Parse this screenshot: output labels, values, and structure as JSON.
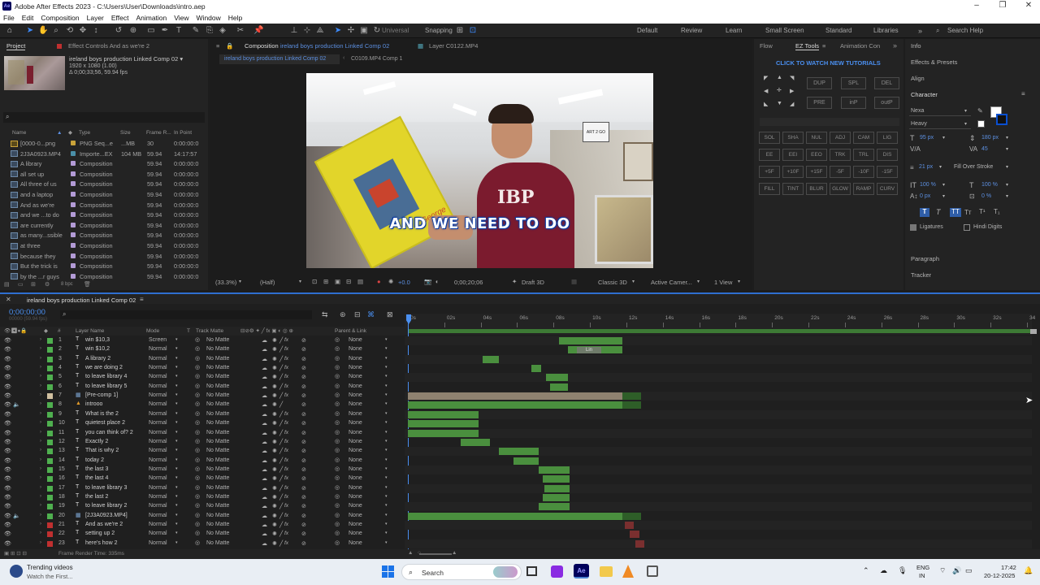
{
  "window": {
    "title": "Adobe After Effects 2023 - C:\\Users\\User\\Downloads\\intro.aep",
    "logo": "Ae"
  },
  "menu": [
    "File",
    "Edit",
    "Composition",
    "Layer",
    "Effect",
    "Animation",
    "View",
    "Window",
    "Help"
  ],
  "toolbar": {
    "universal": "Universal",
    "snapping": "Snapping"
  },
  "workspaces": [
    "Default",
    "Review",
    "Learn",
    "Small Screen",
    "Standard",
    "Libraries"
  ],
  "search_help": "Search Help",
  "project": {
    "tab": "Project",
    "effect_tab": "Effect Controls And as we're 2",
    "comp_name": "ireland boys production Linked Comp 02 ▾",
    "comp_res": "1920 x 1080 (1.00)",
    "comp_dur": "Δ 0;00;33;56, 59.94 fps",
    "headers": [
      "Name",
      "Type",
      "Size",
      "Frame R...",
      "In Point"
    ],
    "bpc": "8 bpc",
    "items": [
      {
        "name": "[0000-0...png",
        "type": "PNG Seq...e",
        "size": "...MB",
        "fr": "30",
        "in": "0:00:00:0",
        "kind": "seq",
        "color": "#c9a33a"
      },
      {
        "name": "2J3A0923.MP4",
        "type": "Importe...EX",
        "size": "104 MB",
        "fr": "59.94",
        "in": "14:17:57",
        "kind": "mov",
        "color": "#4a8fa8"
      },
      {
        "name": "A library",
        "type": "Composition",
        "size": "",
        "fr": "59.94",
        "in": "0:00:00:0",
        "kind": "comp",
        "color": "#b39bd6"
      },
      {
        "name": "all set up",
        "type": "Composition",
        "size": "",
        "fr": "59.94",
        "in": "0:00:00:0",
        "kind": "comp",
        "color": "#b39bd6"
      },
      {
        "name": "All three of us",
        "type": "Composition",
        "size": "",
        "fr": "59.94",
        "in": "0:00:00:0",
        "kind": "comp",
        "color": "#b39bd6"
      },
      {
        "name": "and a laptop",
        "type": "Composition",
        "size": "",
        "fr": "59.94",
        "in": "0:00:00:0",
        "kind": "comp",
        "color": "#b39bd6"
      },
      {
        "name": "And as we're",
        "type": "Composition",
        "size": "",
        "fr": "59.94",
        "in": "0:00:00:0",
        "kind": "comp",
        "color": "#b39bd6"
      },
      {
        "name": "and we ...to do",
        "type": "Composition",
        "size": "",
        "fr": "59.94",
        "in": "0:00:00:0",
        "kind": "comp",
        "color": "#b39bd6"
      },
      {
        "name": "are currently",
        "type": "Composition",
        "size": "",
        "fr": "59.94",
        "in": "0:00:00:0",
        "kind": "comp",
        "color": "#b39bd6"
      },
      {
        "name": "as many...ssible",
        "type": "Composition",
        "size": "",
        "fr": "59.94",
        "in": "0:00:00:0",
        "kind": "comp",
        "color": "#b39bd6"
      },
      {
        "name": "at three",
        "type": "Composition",
        "size": "",
        "fr": "59.94",
        "in": "0:00:00:0",
        "kind": "comp",
        "color": "#b39bd6"
      },
      {
        "name": "because they",
        "type": "Composition",
        "size": "",
        "fr": "59.94",
        "in": "0:00:00:0",
        "kind": "comp",
        "color": "#b39bd6"
      },
      {
        "name": "But the trick is",
        "type": "Composition",
        "size": "",
        "fr": "59.94",
        "in": "0:00:00:0",
        "kind": "comp",
        "color": "#b39bd6"
      },
      {
        "name": "by the ...r guys",
        "type": "Composition",
        "size": "",
        "fr": "59.94",
        "in": "0:00:00:0",
        "kind": "comp",
        "color": "#b39bd6"
      }
    ]
  },
  "viewer": {
    "tab_comp": "Composition",
    "tab_comp_name": "ireland boys production Linked Comp 02",
    "tab_layer": "Layer C0122.MP4",
    "sub_tab1": "ireland boys production Linked Comp 02",
    "sub_tab2": "C0109.MP4 Comp 1",
    "caption": "AND WE NEED TO DO",
    "book_text": "George",
    "shirt_text": "IBP",
    "sign_text": "ART 2 GO",
    "zoom": "(33.3%)",
    "quality": "(Half)",
    "exposure": "+0.0",
    "timecode": "0;00;20;06",
    "draft": "Draft 3D",
    "renderer": "Classic 3D",
    "camera": "Active Camer...",
    "views": "1 View"
  },
  "eztools": {
    "tabs": [
      "Flow",
      "EZ Tools",
      "Animation Con"
    ],
    "cta": "CLICK TO WATCH NEW TUTORIALS",
    "top_buttons": [
      "DUP",
      "SPL",
      "DEL",
      "PRE",
      "inP",
      "outP"
    ],
    "grid": [
      "SOL",
      "SHA",
      "NUL",
      "ADJ",
      "CAM",
      "LIG",
      "EE",
      "EEI",
      "EEO",
      "TRK",
      "TRL",
      "DIS",
      "+5F",
      "+10F",
      "+15F",
      "-5F",
      "-10F",
      "-15F",
      "FILL",
      "TINT",
      "BLUR",
      "GLOW",
      "RAMP",
      "CURV"
    ]
  },
  "right_panel": {
    "info": "Info",
    "effects": "Effects & Presets",
    "align": "Align",
    "character": "Character",
    "font": "Nexa",
    "style": "Heavy",
    "size": "95 px",
    "leading": "180 px",
    "tracking": "45",
    "kerning": "",
    "stroke": "21 px",
    "stroke_mode": "Fill Over Stroke",
    "vscale": "100 %",
    "hscale": "100 %",
    "baseline": "0 px",
    "tsume": "0 %",
    "ligatures": "Ligatures",
    "hindi": "Hindi Digits",
    "paragraph": "Paragraph",
    "tracker": "Tracker",
    "fill_color": "#ffffff",
    "stroke_color": "#0a4fd0"
  },
  "timeline": {
    "tab": "ireland boys production Linked Comp 02",
    "timecode": "0;00;00;00",
    "subtime": "00000 (59.94 fps)",
    "headers": {
      "layer": "Layer Name",
      "mode": "Mode",
      "t": "T",
      "matte": "Track Matte",
      "parent": "Parent & Link"
    },
    "ticks": [
      "0s",
      "02s",
      "04s",
      "06s",
      "08s",
      "10s",
      "12s",
      "14s",
      "16s",
      "18s",
      "20s",
      "22s",
      "24s",
      "26s",
      "28s",
      "30s",
      "32s",
      "34"
    ],
    "duration_s": 34,
    "bar_label": "Lin",
    "render_time": "Frame Render Time: 335ms",
    "layers": [
      {
        "n": "1",
        "name": "win $10,3",
        "mode": "Screen",
        "kind": "T",
        "start": 8.3,
        "end": 11.8,
        "style": "green"
      },
      {
        "n": "2",
        "name": "win $10,2",
        "mode": "Normal",
        "kind": "T",
        "start": 8.8,
        "end": 11.8,
        "style": "green"
      },
      {
        "n": "3",
        "name": "A library 2",
        "mode": "Normal",
        "kind": "T",
        "start": 4.1,
        "end": 5.0,
        "style": "green"
      },
      {
        "n": "4",
        "name": "we are doing 2",
        "mode": "Normal",
        "kind": "T",
        "start": 6.8,
        "end": 7.3,
        "style": "green"
      },
      {
        "n": "5",
        "name": "to leave library 4",
        "mode": "Normal",
        "kind": "T",
        "start": 7.6,
        "end": 8.8,
        "style": "green"
      },
      {
        "n": "6",
        "name": "to leave library 5",
        "mode": "Normal",
        "kind": "T",
        "start": 7.8,
        "end": 8.8,
        "style": "green"
      },
      {
        "n": "7",
        "name": "[Pre-comp 1]",
        "mode": "Normal",
        "kind": "C",
        "start": 0.0,
        "end": 11.8,
        "style": "tan"
      },
      {
        "n": "8",
        "name": "introoo",
        "mode": "Normal",
        "kind": "S",
        "start": 0.0,
        "end": 11.8,
        "style": "green"
      },
      {
        "n": "9",
        "name": "What is the 2",
        "mode": "Normal",
        "kind": "T",
        "start": 0.0,
        "end": 3.9,
        "style": "green"
      },
      {
        "n": "10",
        "name": "quietest place 2",
        "mode": "Normal",
        "kind": "T",
        "start": 0.0,
        "end": 3.9,
        "style": "green"
      },
      {
        "n": "11",
        "name": "you can think of? 2",
        "mode": "Normal",
        "kind": "T",
        "start": 0.0,
        "end": 3.9,
        "style": "green"
      },
      {
        "n": "12",
        "name": "Exactly 2",
        "mode": "Normal",
        "kind": "T",
        "start": 2.9,
        "end": 4.5,
        "style": "green"
      },
      {
        "n": "13",
        "name": "That is why 2",
        "mode": "Normal",
        "kind": "T",
        "start": 5.0,
        "end": 7.2,
        "style": "green"
      },
      {
        "n": "14",
        "name": "today 2",
        "mode": "Normal",
        "kind": "T",
        "start": 5.8,
        "end": 7.2,
        "style": "green"
      },
      {
        "n": "15",
        "name": "the last 3",
        "mode": "Normal",
        "kind": "T",
        "start": 7.2,
        "end": 8.9,
        "style": "green"
      },
      {
        "n": "16",
        "name": "the last 4",
        "mode": "Normal",
        "kind": "T",
        "start": 7.4,
        "end": 8.9,
        "style": "green"
      },
      {
        "n": "17",
        "name": "to leave library 3",
        "mode": "Normal",
        "kind": "T",
        "start": 7.5,
        "end": 8.9,
        "style": "green"
      },
      {
        "n": "18",
        "name": "the last 2",
        "mode": "Normal",
        "kind": "T",
        "start": 7.4,
        "end": 8.9,
        "style": "green"
      },
      {
        "n": "19",
        "name": "to leave library 2",
        "mode": "Normal",
        "kind": "T",
        "start": 7.2,
        "end": 8.9,
        "style": "green"
      },
      {
        "n": "20",
        "name": "[2J3A0923.MP4]",
        "mode": "Normal",
        "kind": "M",
        "start": 0.0,
        "end": 11.8,
        "style": "green"
      },
      {
        "n": "21",
        "name": "And as we're 2",
        "mode": "Normal",
        "kind": "T",
        "start": 11.9,
        "end": 12.4,
        "style": "red"
      },
      {
        "n": "22",
        "name": "setting up 2",
        "mode": "Normal",
        "kind": "T",
        "start": 12.2,
        "end": 12.7,
        "style": "red"
      },
      {
        "n": "23",
        "name": "here's how 2",
        "mode": "Normal",
        "kind": "T",
        "start": 12.5,
        "end": 13.0,
        "style": "red"
      }
    ],
    "matte_value": "No Matte",
    "parent_value": "None"
  },
  "taskbar": {
    "trending_title": "Trending videos",
    "trending_sub": "Watch the First...",
    "search": "Search",
    "lang1": "ENG",
    "lang2": "IN",
    "time": "17:42",
    "date": "20-12-2025"
  }
}
